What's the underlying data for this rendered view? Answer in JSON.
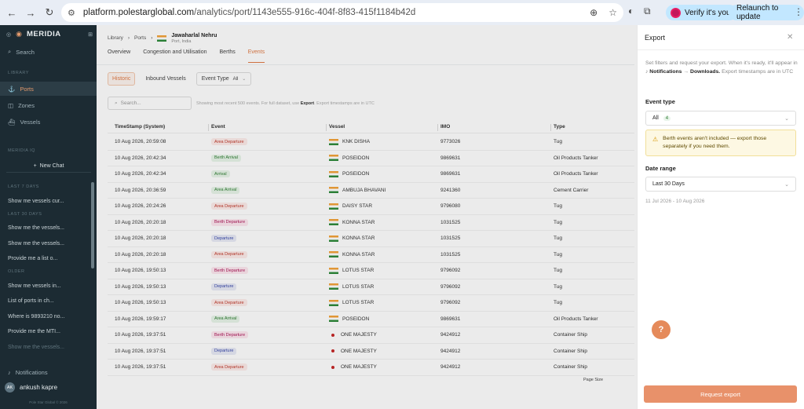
{
  "browser": {
    "url_host": "platform.polestarglobal.com",
    "url_path": "/analytics/port/1143e555-916c-404f-8f83-415f1184b42d",
    "verify_label": "Verify it's you",
    "relaunch_label": "Relaunch to update"
  },
  "sidebar": {
    "brand": "MERIDIA",
    "search_label": "Search",
    "section_library": "LIBRARY",
    "items": [
      {
        "label": "Ports",
        "icon": "anchor-icon",
        "active": true
      },
      {
        "label": "Zones",
        "icon": "zone-icon",
        "active": false
      },
      {
        "label": "Vessels",
        "icon": "vessel-icon",
        "active": false
      }
    ],
    "section_iq": "MERIDIA IQ",
    "new_chat_label": "New Chat",
    "chat_sections": [
      {
        "title": "LAST 7 DAYS",
        "chats": [
          "Show me vessels cur..."
        ]
      },
      {
        "title": "LAST 30 DAYS",
        "chats": [
          "Show me the vessels...",
          "Show me the vessels...",
          "Provide me a list o..."
        ]
      },
      {
        "title": "OLDER",
        "chats": [
          "Show me vessels in...",
          "List of ports in ch...",
          "Where is 9893210 no...",
          "Provide me the MTI...",
          "Show me the vessels..."
        ]
      }
    ],
    "notifications_label": "Notifications",
    "user_initials": "AK",
    "user_name": "ankush kapre",
    "footer": "Pole Star Global © 2026"
  },
  "breadcrumb": {
    "library": "Library",
    "ports": "Ports",
    "port_name": "Jawaharlal Nehru",
    "port_sub": "Port, India"
  },
  "tabs": [
    "Overview",
    "Congestion and Utilisation",
    "Berths",
    "Events"
  ],
  "subtabs": {
    "historic": "Historic",
    "inbound": "Inbound Vessels",
    "event_type_label": "Event Type",
    "event_type_value": "All"
  },
  "search": {
    "placeholder": "Search...",
    "note_pre": "Showing most recent 500 events. For full dataset, use ",
    "note_bold": "Export",
    "note_post": ". Export timestamps are in UTC"
  },
  "table": {
    "headers": [
      "TimeStamp (System)",
      "Event",
      "Vessel",
      "IMO",
      "Type"
    ],
    "rows": [
      [
        "10 Aug 2026, 20:59:08",
        "Area Departure",
        "KNK DISHA",
        "9773026",
        "Tug",
        "flag"
      ],
      [
        "10 Aug 2026, 20:42:34",
        "Berth Arrival",
        "POSEIDON",
        "9869631",
        "Oil Products Tanker",
        "flag"
      ],
      [
        "10 Aug 2026, 20:42:34",
        "Arrival",
        "POSEIDON",
        "9869631",
        "Oil Products Tanker",
        "flag"
      ],
      [
        "10 Aug 2026, 20:36:59",
        "Area Arrival",
        "AMBUJA BHAVANI",
        "9241360",
        "Cement Carrier",
        "flag"
      ],
      [
        "10 Aug 2026, 20:24:26",
        "Area Departure",
        "DAISY STAR",
        "9796080",
        "Tug",
        "flag"
      ],
      [
        "10 Aug 2026, 20:20:18",
        "Berth Departure",
        "KONNA STAR",
        "1031525",
        "Tug",
        "flag"
      ],
      [
        "10 Aug 2026, 20:20:18",
        "Departure",
        "KONNA STAR",
        "1031525",
        "Tug",
        "flag"
      ],
      [
        "10 Aug 2026, 20:20:18",
        "Area Departure",
        "KONNA STAR",
        "1031525",
        "Tug",
        "flag"
      ],
      [
        "10 Aug 2026, 19:50:13",
        "Berth Departure",
        "LOTUS STAR",
        "9796092",
        "Tug",
        "flag"
      ],
      [
        "10 Aug 2026, 19:50:13",
        "Departure",
        "LOTUS STAR",
        "9796092",
        "Tug",
        "flag"
      ],
      [
        "10 Aug 2026, 19:50:13",
        "Area Departure",
        "LOTUS STAR",
        "9796092",
        "Tug",
        "flag"
      ],
      [
        "10 Aug 2026, 19:59:17",
        "Area Arrival",
        "POSEIDON",
        "9869631",
        "Oil Products Tanker",
        "flag"
      ],
      [
        "10 Aug 2026, 19:37:51",
        "Berth Departure",
        "ONE MAJESTY",
        "9424912",
        "Container Ship",
        "dot"
      ],
      [
        "10 Aug 2026, 19:37:51",
        "Departure",
        "ONE MAJESTY",
        "9424912",
        "Container Ship",
        "dot"
      ],
      [
        "10 Aug 2026, 19:37:51",
        "Area Departure",
        "ONE MAJESTY",
        "9424912",
        "Container Ship",
        "dot"
      ]
    ],
    "page_size_label": "Page Size"
  },
  "pill_colors": {
    "Area Departure": [
      "#fdecea",
      "#c0392b"
    ],
    "Berth Arrival": [
      "#e8f5e9",
      "#2e7d32"
    ],
    "Arrival": [
      "#e8f5e9",
      "#2e7d32"
    ],
    "Area Arrival": [
      "#e8f5e9",
      "#2e7d32"
    ],
    "Berth Departure": [
      "#fde8ef",
      "#ad1457"
    ],
    "Departure": [
      "#e8eaf6",
      "#3949ab"
    ]
  },
  "export_panel": {
    "title": "Export",
    "desc_pre": "Set filters and request your export. When it's ready, it'll appear in ",
    "desc_b1": "Notifications",
    "desc_arrow": " → ",
    "desc_b2": "Downloads.",
    "desc_post": " Export timestamps are in UTC",
    "event_type_label": "Event type",
    "event_type_value": "All",
    "event_type_count": "4",
    "warning": "Berth events aren't included — export those separately if you need them.",
    "date_range_label": "Date range",
    "date_range_value": "Last 30 Days",
    "date_range_text": "11 Jul 2026 - 10 Aug 2026",
    "request_button": "Request export",
    "help": "?"
  }
}
